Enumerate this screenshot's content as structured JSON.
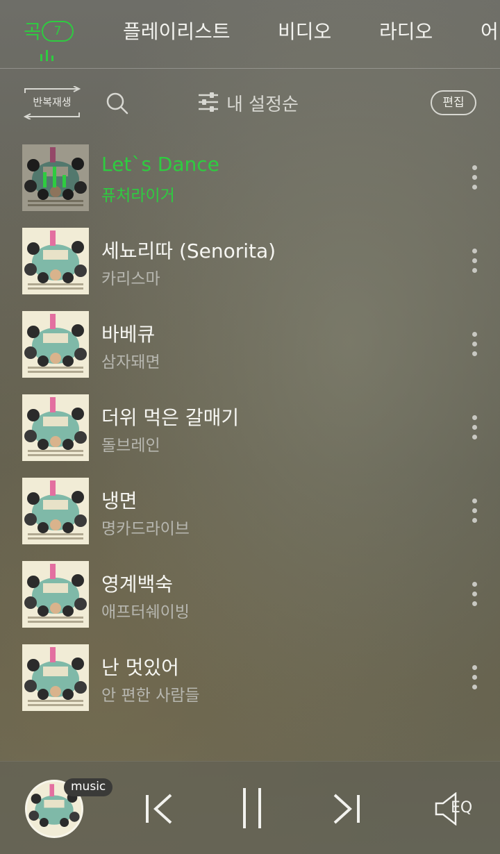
{
  "tabs": {
    "items": [
      {
        "label": "곡",
        "count": "7",
        "active": true
      },
      {
        "label": "플레이리스트"
      },
      {
        "label": "비디오"
      },
      {
        "label": "라디오"
      },
      {
        "label": "어"
      }
    ]
  },
  "toolbar": {
    "repeat_label": "반복재생",
    "search_icon": "search-icon",
    "sort_label": "내 설정순",
    "edit_label": "편집"
  },
  "songs": [
    {
      "title": "Let`s Dance",
      "artist": "퓨처라이거",
      "playing": true
    },
    {
      "title": "세뇨리따 (Senorita)",
      "artist": "카리스마"
    },
    {
      "title": "바베큐",
      "artist": "삼자돼면"
    },
    {
      "title": "더위 먹은 갈매기",
      "artist": "돌브레인"
    },
    {
      "title": "냉면",
      "artist": "명카드라이브"
    },
    {
      "title": "영계백숙",
      "artist": "애프터쉐이빙"
    },
    {
      "title": "난 멋있어",
      "artist": "안 편한 사람들"
    }
  ],
  "player": {
    "badge": "music",
    "eq_label": "EQ"
  },
  "colors": {
    "accent": "#2ecc40",
    "text": "#f6f6f2",
    "subtext": "#b7b7b0"
  }
}
